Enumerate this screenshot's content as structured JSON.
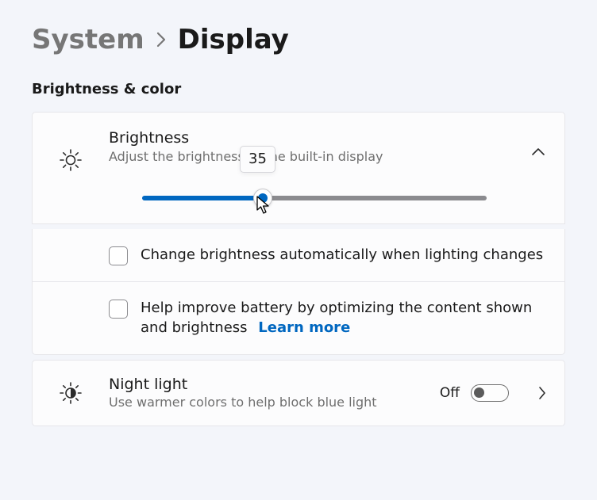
{
  "breadcrumb": {
    "parent": "System",
    "current": "Display"
  },
  "section_title": "Brightness & color",
  "brightness": {
    "title": "Brightness",
    "subtitle": "Adjust the brightness of the built-in display",
    "value": 35,
    "slider_percent": 35,
    "auto_checkbox_label": "Change brightness automatically when lighting changes",
    "battery_checkbox_label": "Help improve battery by optimizing the content shown and brightness",
    "learn_more": "Learn more"
  },
  "night_light": {
    "title": "Night light",
    "subtitle": "Use warmer colors to help block blue light",
    "toggle_state": "Off"
  }
}
